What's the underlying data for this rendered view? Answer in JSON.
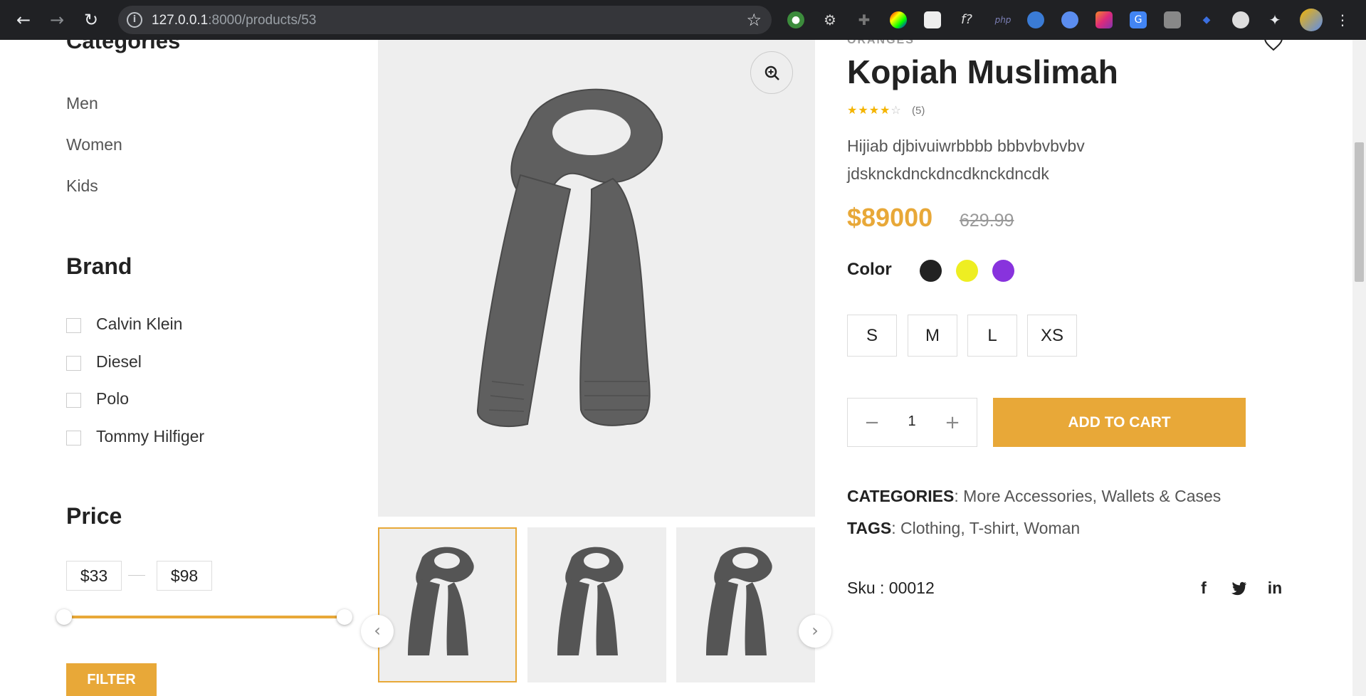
{
  "browser": {
    "url_host": "127.0.0.1",
    "url_path": ":8000/products/53"
  },
  "sidebar": {
    "categories_heading": "Categories",
    "categories": [
      "Men",
      "Women",
      "Kids"
    ],
    "brand_heading": "Brand",
    "brands": [
      "Calvin Klein",
      "Diesel",
      "Polo",
      "Tommy Hilfiger"
    ],
    "price_heading": "Price",
    "price_min": "$33",
    "price_max": "$98",
    "filter_label": "FILTER"
  },
  "product": {
    "brand": "ORANGES",
    "title": "Kopiah Muslimah",
    "rating": 4,
    "review_count": "(5)",
    "description": "Hijiab djbivuiwrbbbb bbbvbvbvbv jdsknckdnckdncdknckdncdk",
    "price": "$89000",
    "old_price": "629.99",
    "color_label": "Color",
    "colors": [
      "#222222",
      "#eeee22",
      "#8833dd"
    ],
    "sizes": [
      "S",
      "M",
      "L",
      "XS"
    ],
    "quantity": "1",
    "add_to_cart": "ADD TO CART",
    "categories_label": "CATEGORIES",
    "categories_value": ": More Accessories, Wallets & Cases",
    "tags_label": "TAGS",
    "tags_value": ": Clothing, T-shirt, Woman",
    "sku": "Sku : 00012",
    "social": [
      "f",
      "t",
      "in"
    ]
  },
  "colors": {
    "accent": "#e8a838"
  }
}
